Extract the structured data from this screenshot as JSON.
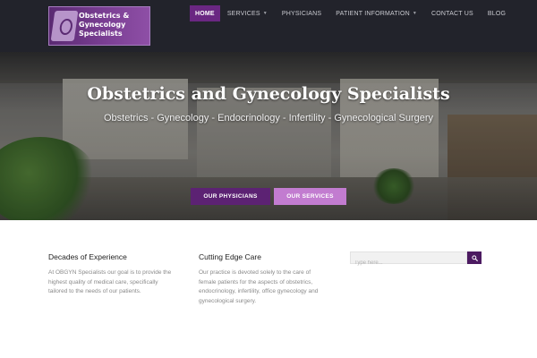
{
  "logo": {
    "lines": [
      "Obstetrics &",
      "Gynecology",
      "Specialists"
    ]
  },
  "nav": {
    "items": [
      {
        "label": "HOME",
        "active": true
      },
      {
        "label": "SERVICES",
        "dropdown": true
      },
      {
        "label": "PHYSICIANS"
      },
      {
        "label": "PATIENT INFORMATION",
        "dropdown": true
      },
      {
        "label": "CONTACT US"
      },
      {
        "label": "BLOG"
      }
    ]
  },
  "hero": {
    "title": "Obstetrics and Gynecology Specialists",
    "subtitle": "Obstetrics - Gynecology - Endocrinology - Infertility - Gynecological Surgery",
    "primary_button": "OUR PHYSICIANS",
    "secondary_button": "OUR SERVICES"
  },
  "columns": [
    {
      "title": "Decades of Experience",
      "lines": [
        "At OBGYN Specialists our goal is to provide the",
        "highest quality of medical care, specifically",
        "tailored to the needs of our patients."
      ]
    },
    {
      "title": "Cutting Edge Care",
      "lines": [
        "Our practice is devoted solely to the care of",
        "female patients for the aspects of obstetrics,",
        "endocrinology, infertility, office gynecology and",
        "gynecological surgery."
      ]
    }
  ],
  "search": {
    "placeholder": "Type here..."
  },
  "colors": {
    "header_bg": "#22232b",
    "brand_purple": "#6a2782",
    "button_primary": "#5c2273",
    "button_secondary": "#c27cd0"
  },
  "icons": {
    "search_button": "search-icon",
    "dropdown": "chevron-down-icon"
  }
}
